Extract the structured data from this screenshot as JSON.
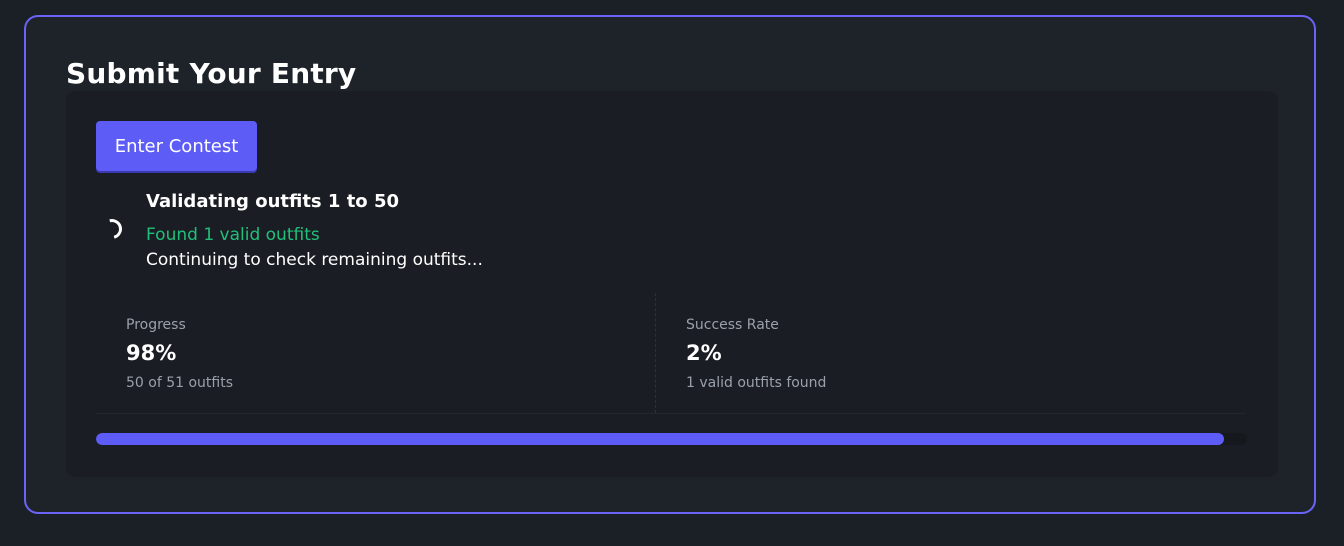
{
  "header": {
    "title": "Submit Your Entry"
  },
  "actions": {
    "enter_label": "Enter Contest"
  },
  "status": {
    "heading": "Validating outfits 1 to 50",
    "found": "Found 1 valid outfits",
    "continuing": "Continuing to check remaining outfits..."
  },
  "stats": {
    "progress": {
      "label": "Progress",
      "value": "98%",
      "sub": "50 of 51 outfits"
    },
    "success": {
      "label": "Success Rate",
      "value": "2%",
      "sub": "1 valid outfits found"
    }
  },
  "progress_bar": {
    "fraction": 0.98
  },
  "colors": {
    "accent": "#5d5cf6",
    "success_text": "#21c07a",
    "background": "#1e2329"
  },
  "icons": {
    "spinner": "loading-spinner-icon"
  }
}
